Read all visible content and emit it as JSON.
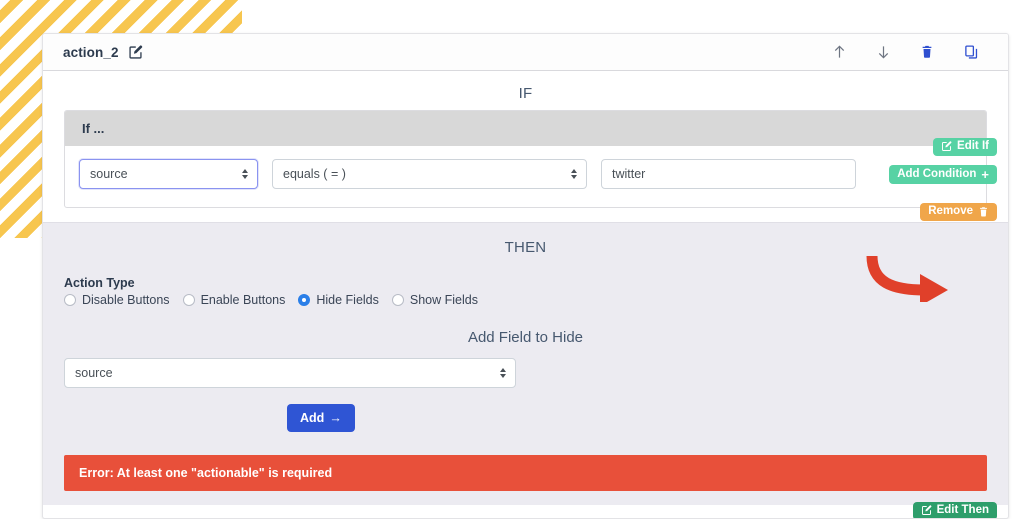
{
  "card": {
    "title": "action_2",
    "title_edit_icon": "pencil-square-icon",
    "tools": [
      {
        "name": "move-up-icon",
        "glyph": "↑",
        "color": "#6e7582"
      },
      {
        "name": "move-down-icon",
        "glyph": "↓",
        "color": "#6e7582"
      },
      {
        "name": "delete-icon",
        "glyph": "trash",
        "color": "#2f4fd0"
      },
      {
        "name": "duplicate-icon",
        "glyph": "copy",
        "color": "#2f4fd0"
      }
    ]
  },
  "if_section": {
    "heading": "IF",
    "edit_if_label": "Edit If",
    "add_condition_label": "Add Condition",
    "add_condition_suffix": "+",
    "panel_header": "If ...",
    "remove_label": "Remove",
    "condition": {
      "field_value": "source",
      "operator_value": "equals ( = )",
      "value_text": "twitter"
    }
  },
  "then_section": {
    "heading": "THEN",
    "edit_then_label": "Edit Then",
    "action_type_label": "Action Type",
    "radios": [
      {
        "label": "Disable Buttons",
        "selected": false
      },
      {
        "label": "Enable Buttons",
        "selected": false
      },
      {
        "label": "Hide Fields",
        "selected": true
      },
      {
        "label": "Show Fields",
        "selected": false
      }
    ],
    "add_field_title": "Add Field to Hide",
    "field_select_value": "source",
    "add_button_label": "Add",
    "add_button_arrow": "→",
    "error_message": "Error: At least one \"actionable\" is required"
  },
  "colors": {
    "accent_green_light": "#57d2a4",
    "accent_green_dark": "#2e9e6b",
    "accent_orange": "#f0a64a",
    "accent_blue": "#2f55d4",
    "error_red": "#e8503a",
    "stripe_yellow": "#f7c64f",
    "annotation_red": "#e0402a"
  }
}
